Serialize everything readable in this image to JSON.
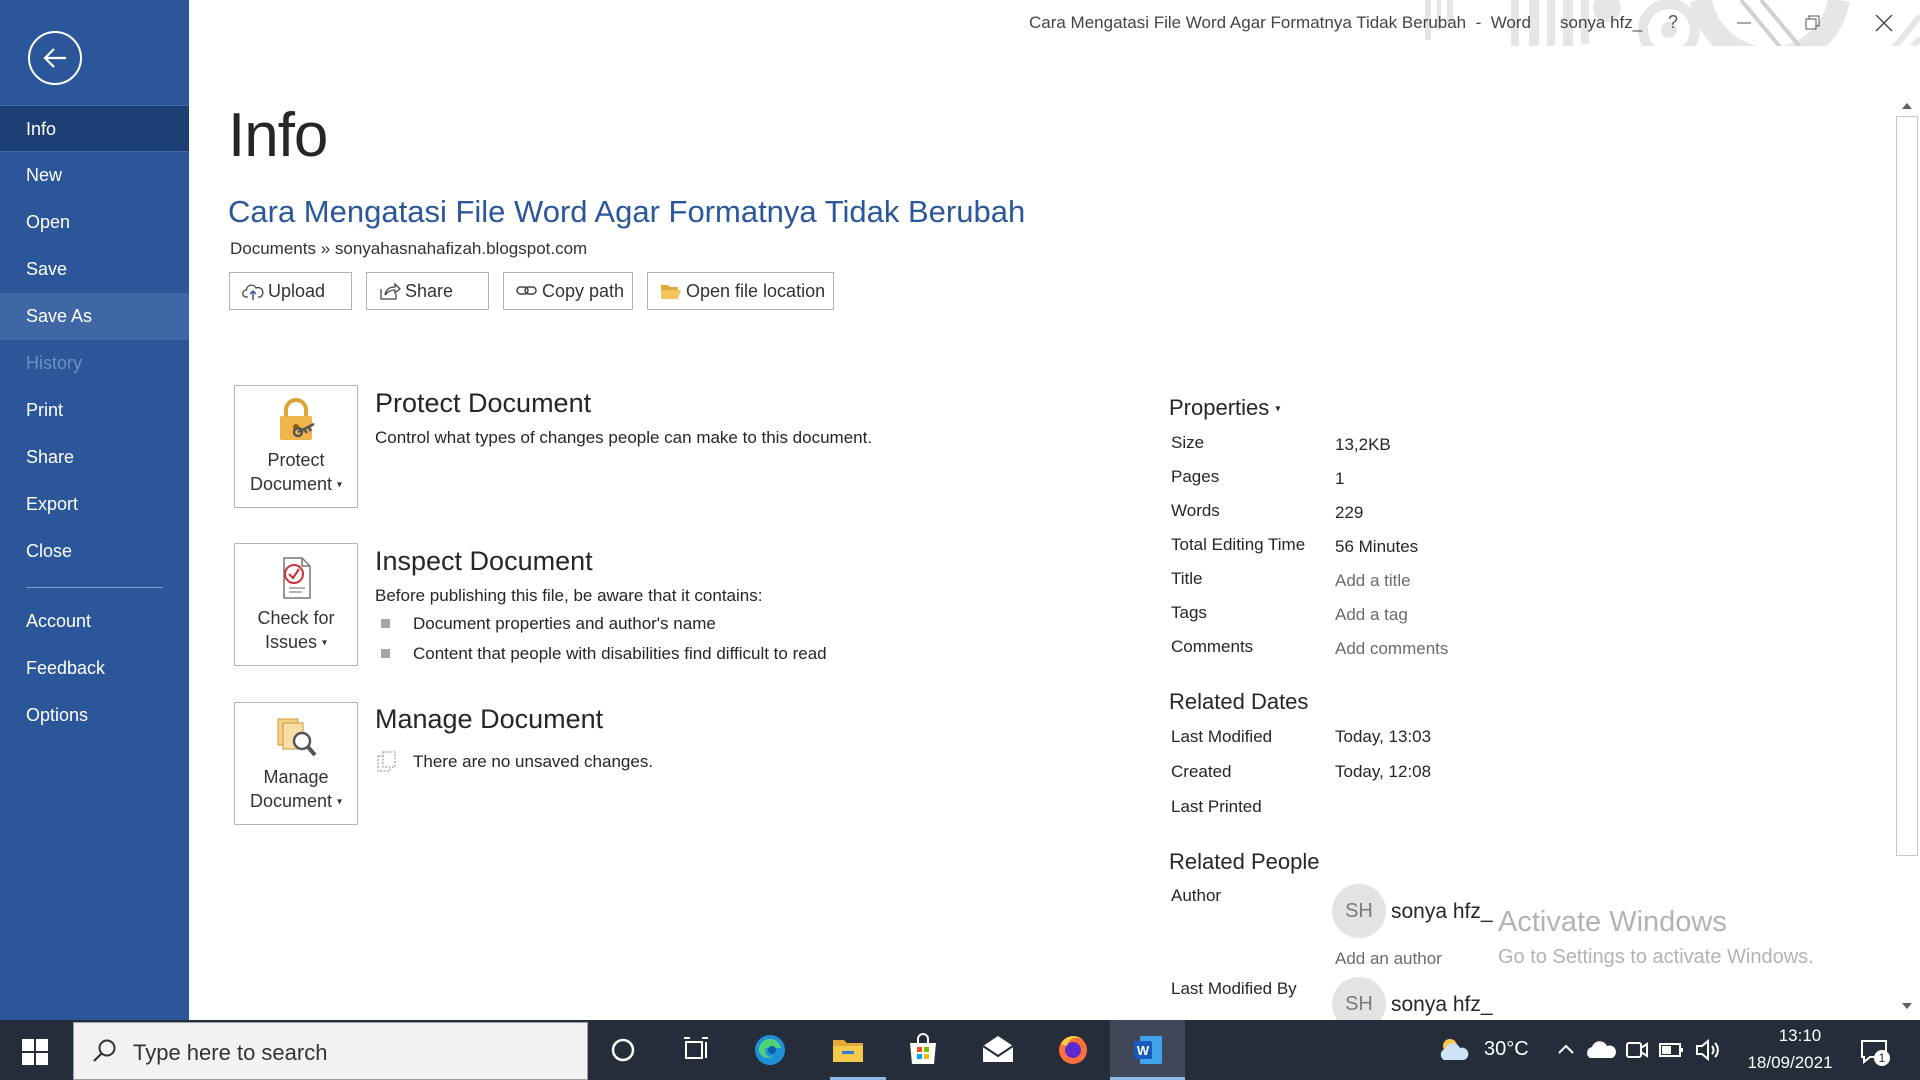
{
  "window": {
    "title": "Cara Mengatasi File Word Agar Formatnya Tidak Berubah  -  Word",
    "user": "sonya hfz_",
    "help": "?"
  },
  "sidebar": {
    "items": [
      {
        "label": "Info"
      },
      {
        "label": "New"
      },
      {
        "label": "Open"
      },
      {
        "label": "Save"
      },
      {
        "label": "Save As"
      },
      {
        "label": "History"
      },
      {
        "label": "Print"
      },
      {
        "label": "Share"
      },
      {
        "label": "Export"
      },
      {
        "label": "Close"
      },
      {
        "label": "Account"
      },
      {
        "label": "Feedback"
      },
      {
        "label": "Options"
      }
    ]
  },
  "main": {
    "page_title": "Info",
    "doc_title": "Cara Mengatasi File Word Agar Formatnya Tidak Berubah",
    "doc_path": "Documents » sonyahasnahafizah.blogspot.com",
    "actions": {
      "upload": "Upload",
      "share": "Share",
      "copy_path": "Copy path",
      "open_location": "Open file location"
    },
    "protect": {
      "button_line1": "Protect",
      "button_line2": "Document",
      "title": "Protect Document",
      "desc": "Control what types of changes people can make to this document."
    },
    "inspect": {
      "button_line1": "Check for",
      "button_line2": "Issues",
      "title": "Inspect Document",
      "desc": "Before publishing this file, be aware that it contains:",
      "items": [
        "Document properties and author's name",
        "Content that people with disabilities find difficult to read"
      ]
    },
    "manage": {
      "button_line1": "Manage",
      "button_line2": "Document",
      "title": "Manage Document",
      "desc": "There are no unsaved changes."
    }
  },
  "properties": {
    "heading": "Properties",
    "rows": [
      {
        "label": "Size",
        "value": "13,2KB"
      },
      {
        "label": "Pages",
        "value": "1"
      },
      {
        "label": "Words",
        "value": "229"
      },
      {
        "label": "Total Editing Time",
        "value": "56 Minutes"
      },
      {
        "label": "Title",
        "value": "Add a title"
      },
      {
        "label": "Tags",
        "value": "Add a tag"
      },
      {
        "label": "Comments",
        "value": "Add comments"
      }
    ],
    "related_dates": {
      "heading": "Related Dates",
      "rows": [
        {
          "label": "Last Modified",
          "value": "Today, 13:03"
        },
        {
          "label": "Created",
          "value": "Today, 12:08"
        },
        {
          "label": "Last Printed",
          "value": ""
        }
      ]
    },
    "related_people": {
      "heading": "Related People",
      "author_label": "Author",
      "author_initials": "SH",
      "author_name": "sonya hfz_",
      "add_author": "Add an author",
      "last_modified_by_label": "Last Modified By",
      "last_modified_initials": "SH",
      "last_modified_name": "sonya hfz_"
    }
  },
  "watermark": {
    "title": "Activate Windows",
    "subtitle": "Go to Settings to activate Windows."
  },
  "taskbar": {
    "search_placeholder": "Type here to search",
    "weather": "30°C",
    "time": "13:10",
    "date": "18/09/2021",
    "notification_count": "1"
  },
  "colors": {
    "sidebar": "#2b579a",
    "sidebar_active": "#1e3f74",
    "accent": "#2b579a",
    "taskbar": "#252c3a"
  }
}
